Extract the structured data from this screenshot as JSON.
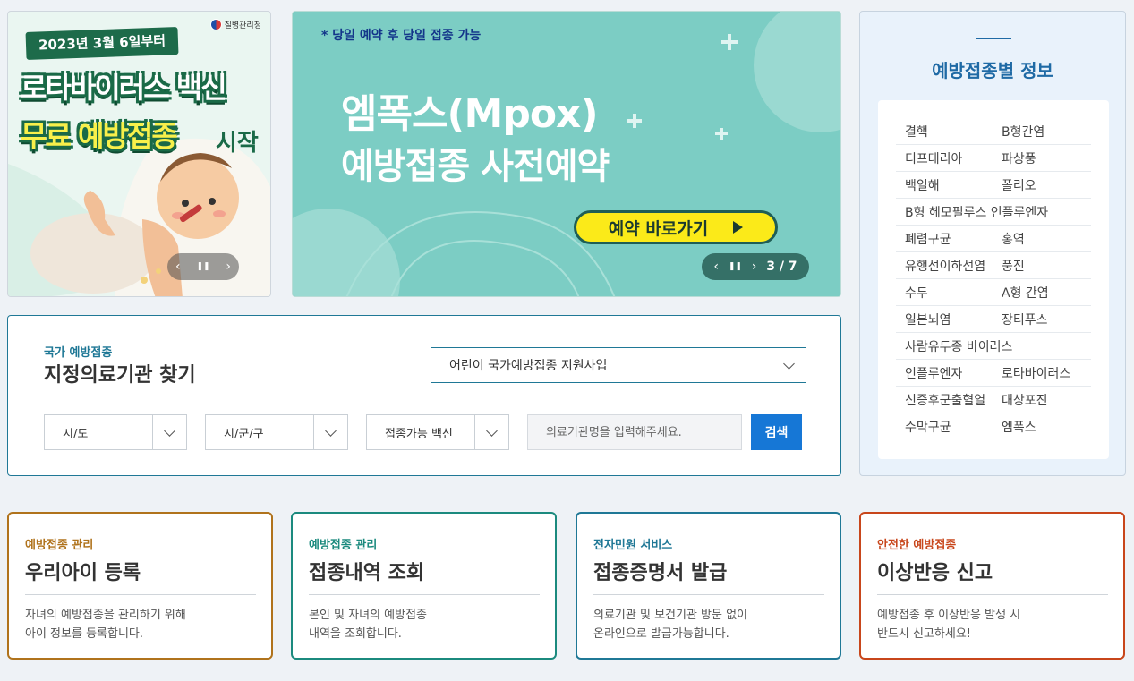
{
  "small_banner": {
    "logo_text": "질병관리청",
    "date_text": "2023년 3월 6일부터",
    "title_line1": "로타바이러스 백신",
    "title_line2": "무료 예방접종",
    "title_suffix": "시작",
    "prev_icon": "‹",
    "pause_icon": "❚❚",
    "next_icon": "›"
  },
  "main_banner": {
    "note": "* 당일 예약 후 당일 접종 가능",
    "title_line1": "엠폭스(Mpox)",
    "title_line2": "예방접종 사전예약",
    "cta_label": "예약 바로가기",
    "prev_icon": "‹",
    "pause_icon": "❚❚",
    "next_icon": "›",
    "page_indicator": "3 / 7"
  },
  "info_panel": {
    "title": "예방접종별 정보",
    "rows": [
      [
        "결핵",
        "B형간염"
      ],
      [
        "디프테리아",
        "파상풍"
      ],
      [
        "백일해",
        "폴리오"
      ],
      [
        "B형 헤모필루스 인플루엔자"
      ],
      [
        "폐렴구균",
        "홍역"
      ],
      [
        "유행선이하선염",
        "풍진"
      ],
      [
        "수두",
        "A형 간염"
      ],
      [
        "일본뇌염",
        "장티푸스"
      ],
      [
        "사람유두종 바이러스"
      ],
      [
        "인플루엔자",
        "로타바이러스"
      ],
      [
        "신증후군출혈열",
        "대상포진"
      ],
      [
        "수막구균",
        "엠폭스"
      ]
    ]
  },
  "search": {
    "subtitle": "국가 예방접종",
    "title": "지정의료기관 찾기",
    "program_value": "어린이 국가예방접종 지원사업",
    "sido_value": "시/도",
    "sigungu_value": "시/군/구",
    "vaccine_value": "접종가능 백신",
    "name_placeholder": "의료기관명을 입력해주세요.",
    "search_button": "검색"
  },
  "cards": [
    {
      "category": "예방접종 관리",
      "title": "우리아이 등록",
      "desc_line1": "자녀의 예방접종을 관리하기 위해",
      "desc_line2": "아이 정보를 등록합니다.",
      "color": "#b0731c"
    },
    {
      "category": "예방접종 관리",
      "title": "접종내역 조회",
      "desc_line1": "본인 및 자녀의 예방접종",
      "desc_line2": "내역을 조회합니다.",
      "color": "#1b8a7e"
    },
    {
      "category": "전자민원 서비스",
      "title": "접종증명서 발급",
      "desc_line1": "의료기관 및 보건기관 방문 없이",
      "desc_line2": "온라인으로 발급가능합니다.",
      "color": "#1f7896"
    },
    {
      "category": "안전한 예방접종",
      "title": "이상반응 신고",
      "desc_line1": "예방접종 후 이상반응 발생 시",
      "desc_line2": "반드시 신고하세요!",
      "color": "#c8461b"
    }
  ]
}
